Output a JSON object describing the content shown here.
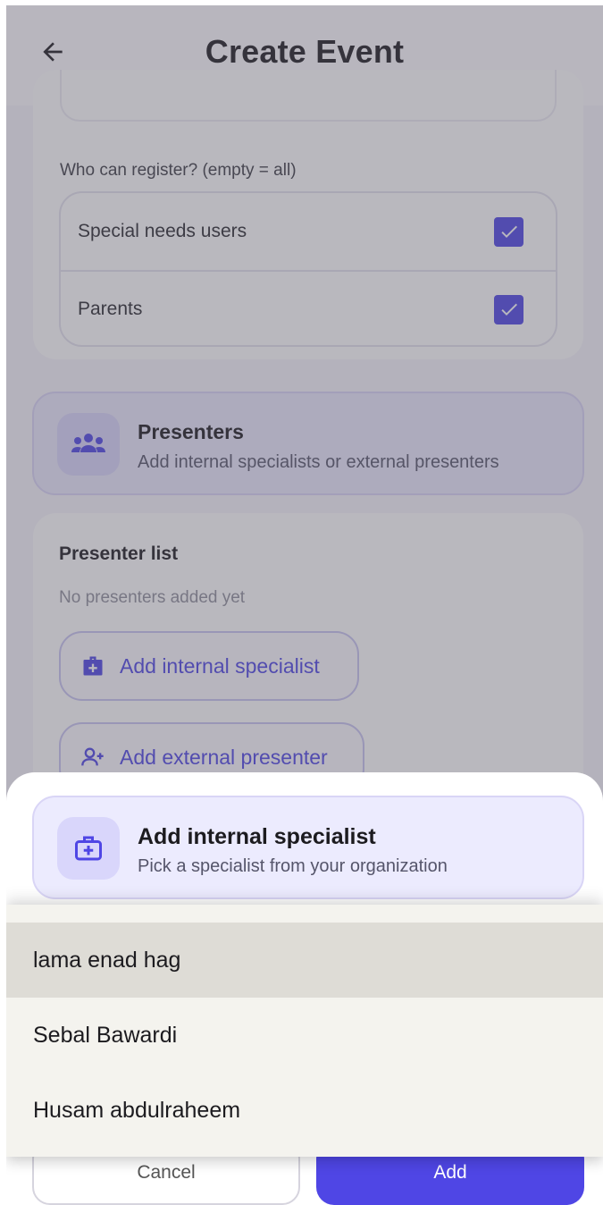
{
  "appbar": {
    "title": "Create Event",
    "back_icon": "arrow-left-icon"
  },
  "registration": {
    "label": "Who can register? (empty = all)",
    "options": [
      {
        "label": "Special needs users",
        "checked": true
      },
      {
        "label": "Parents",
        "checked": true
      }
    ]
  },
  "presenters": {
    "icon": "groups-icon",
    "title": "Presenters",
    "subtitle": "Add internal specialists or external presenters",
    "list_title": "Presenter list",
    "empty_text": "No presenters added yet",
    "add_internal_label": "Add internal specialist",
    "add_external_label": "Add external presenter"
  },
  "sheet": {
    "icon": "medical-case-icon",
    "title": "Add internal specialist",
    "subtitle": "Pick a specialist from your organization",
    "cancel_label": "Cancel",
    "add_label": "Add"
  },
  "dropdown": {
    "options": [
      "lama enad hag",
      "Sebal Bawardi",
      "Husam abdulraheem"
    ],
    "highlighted_index": 0
  },
  "colors": {
    "accent": "#4f46e5",
    "accent_soft": "#ecebfe",
    "scrim": "#585664"
  }
}
